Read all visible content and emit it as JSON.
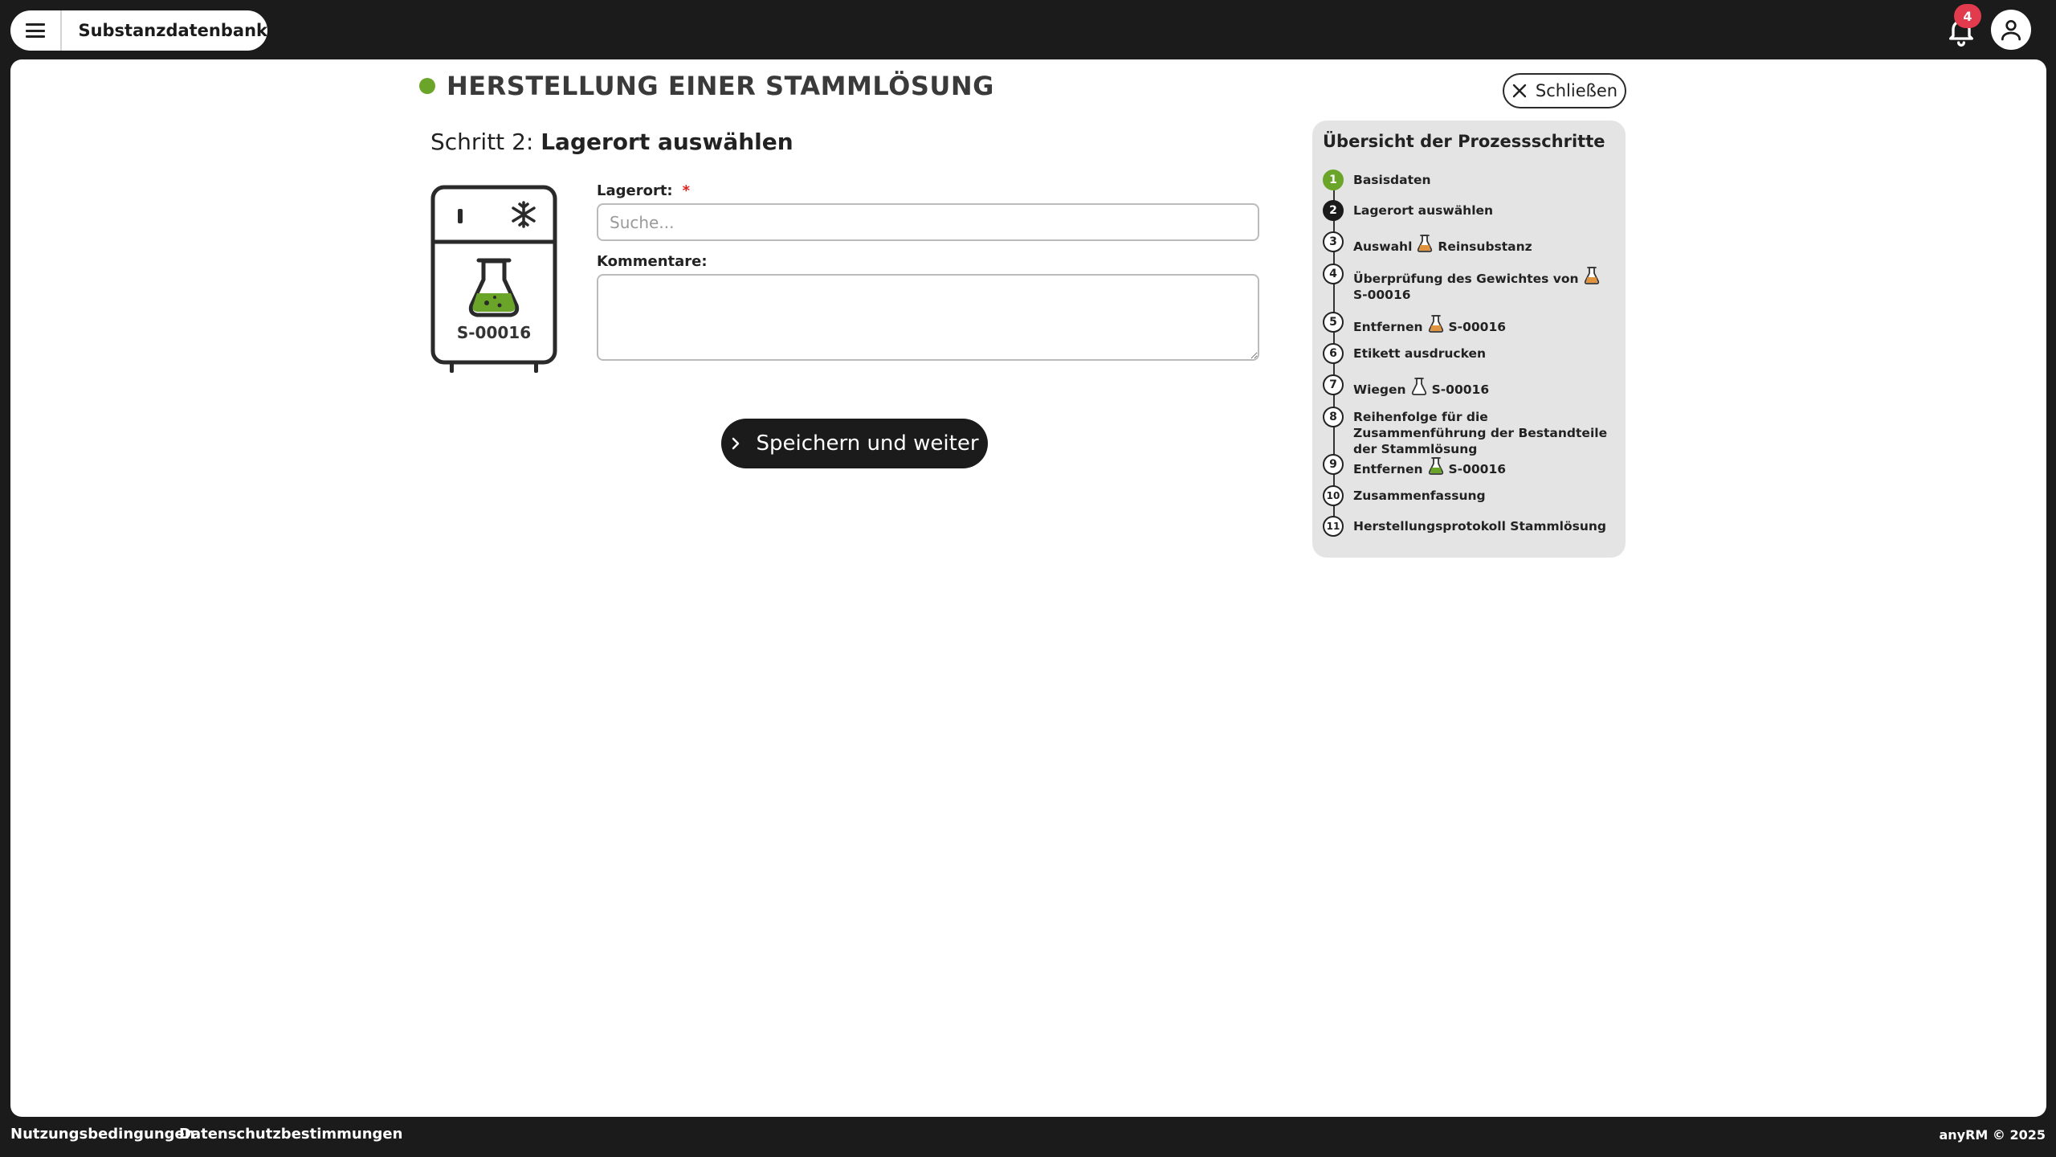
{
  "header": {
    "app_title": "Substanzdatenbank",
    "notification_count": "4"
  },
  "page": {
    "title": "HERSTELLUNG EINER STAMMLÖSUNG",
    "status_color": "#6aa52a",
    "close_label": "Schließen",
    "step_prefix": "Schritt 2:",
    "step_title": "Lagerort auswählen"
  },
  "fridge": {
    "label": "S-00016"
  },
  "form": {
    "location_label": "Lagerort:",
    "location_required": "*",
    "location_placeholder": "Suche...",
    "location_value": "",
    "comments_label": "Kommentare:",
    "comments_value": "",
    "save_label": "Speichern und weiter"
  },
  "overview": {
    "title": "Übersicht der Prozessschritte",
    "steps": [
      {
        "num": "1",
        "state": "done",
        "parts": [
          "Basisdaten"
        ]
      },
      {
        "num": "2",
        "state": "active",
        "parts": [
          "Lagerort auswählen"
        ]
      },
      {
        "num": "3",
        "state": "todo",
        "parts": [
          "Auswahl",
          "Reinsubstanz"
        ],
        "icon": "flask-orange"
      },
      {
        "num": "4",
        "state": "todo",
        "parts": [
          "Überprüfung des Gewichtes von",
          "S-00016"
        ],
        "icon": "flask-orange"
      },
      {
        "num": "5",
        "state": "todo",
        "parts": [
          "Entfernen",
          "S-00016"
        ],
        "icon": "flask-orange"
      },
      {
        "num": "6",
        "state": "todo",
        "parts": [
          "Etikett ausdrucken"
        ]
      },
      {
        "num": "7",
        "state": "todo",
        "parts": [
          "Wiegen",
          "S-00016"
        ],
        "icon": "flask-empty"
      },
      {
        "num": "8",
        "state": "todo",
        "parts": [
          "Reihenfolge für die Zusammenführung der Bestandteile der Stammlösung"
        ]
      },
      {
        "num": "9",
        "state": "todo",
        "parts": [
          "Entfernen",
          "S-00016"
        ],
        "icon": "flask-green"
      },
      {
        "num": "10",
        "state": "todo",
        "parts": [
          "Zusammenfassung"
        ]
      },
      {
        "num": "11",
        "state": "todo",
        "parts": [
          "Herstellungsprotokoll Stammlösung"
        ]
      }
    ]
  },
  "footer": {
    "terms": "Nutzungsbedingungen",
    "privacy": "Datenschutzbestimmungen",
    "copyright": "anyRM © 2025"
  }
}
